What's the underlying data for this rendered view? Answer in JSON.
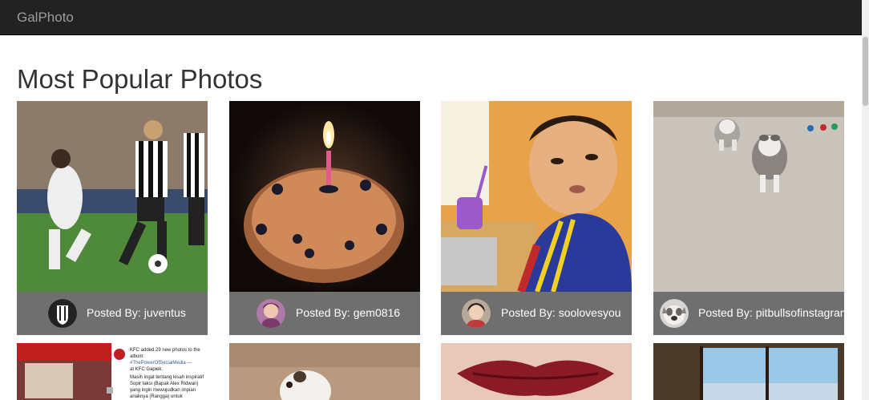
{
  "navbar": {
    "brand": "GalPhoto"
  },
  "page": {
    "title": "Most Popular Photos"
  },
  "caption_prefix": "Posted By:",
  "photos": [
    {
      "user": "juventus",
      "avatar_icon": "juventus-logo-icon"
    },
    {
      "user": "gem0816",
      "avatar_icon": "user-avatar-icon"
    },
    {
      "user": "soolovesyou",
      "avatar_icon": "user-avatar-icon"
    },
    {
      "user": "pitbullsofinstagram",
      "avatar_icon": "dog-avatar-icon"
    }
  ],
  "row2": {
    "kfc_post": {
      "line1": "KFC added 29 new photos to the album:",
      "line2": "#ThePowerOfSocialMedia —",
      "line3": "at KFC Gapiek.",
      "body": "Masih ingat tentang kisah inspiratif Sopir taksi (Bapak Alex Ridwan) yang ingin mewujudkan impian anaknya (Rangga) untuk merayakan ulang tahun di KFC ?"
    }
  },
  "colors": {
    "navbar": "#222222",
    "caption_bg": "#6f6f6f",
    "title": "#333333"
  }
}
